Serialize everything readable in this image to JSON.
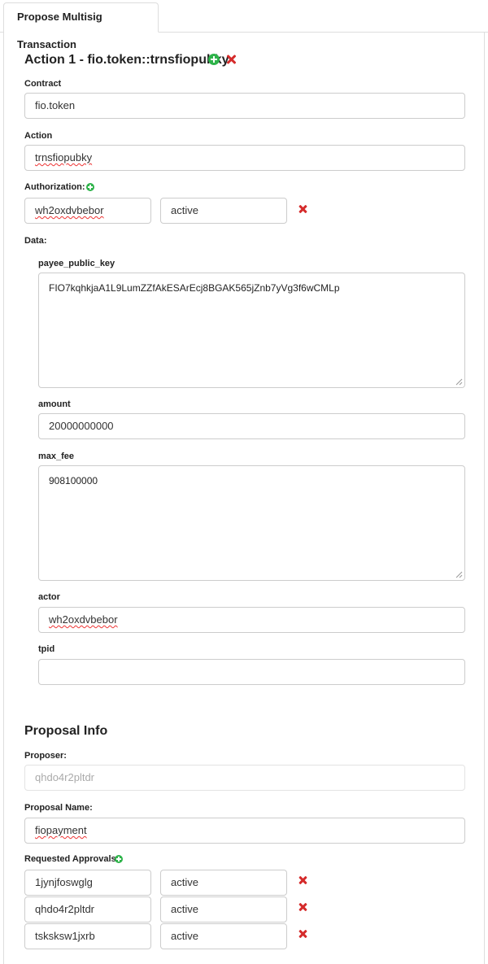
{
  "tab": {
    "label": "Propose Multisig Transaction"
  },
  "action": {
    "title": "Action 1 - fio.token::trnsfiopubky",
    "contract_label": "Contract",
    "contract_value": "fio.token",
    "action_label": "Action",
    "action_value": "trnsfiopubky",
    "authorization_label": "Authorization:",
    "authorization": {
      "actor": "wh2oxdvbebor",
      "permission": "active"
    },
    "data_label": "Data:",
    "fields": {
      "payee_public_key": {
        "label": "payee_public_key",
        "value": "FIO7kqhkjaA1L9LumZZfAkESArEcj8BGAK565jZnb7yVg3f6wCMLp"
      },
      "amount": {
        "label": "amount",
        "value": "20000000000"
      },
      "max_fee": {
        "label": "max_fee",
        "value": "908100000"
      },
      "actor": {
        "label": "actor",
        "value": "wh2oxdvbebor"
      },
      "tpid": {
        "label": "tpid",
        "value": ""
      }
    }
  },
  "proposal": {
    "title": "Proposal Info",
    "proposer_label": "Proposer:",
    "proposer_placeholder": "qhdo4r2pltdr",
    "name_label": "Proposal Name:",
    "name_value": "fiopayment",
    "approvals_label": "Requested Approvals:",
    "approvals": [
      {
        "actor": "1jynjfoswglg",
        "permission": "active"
      },
      {
        "actor": "qhdo4r2pltdr",
        "permission": "active"
      },
      {
        "actor": "tsksksw1jxrb",
        "permission": "active"
      }
    ]
  },
  "icons": {
    "add": "plus-circle-icon",
    "remove": "x-icon",
    "add_color": "#2eb34a",
    "remove_color": "#d52b2b"
  }
}
